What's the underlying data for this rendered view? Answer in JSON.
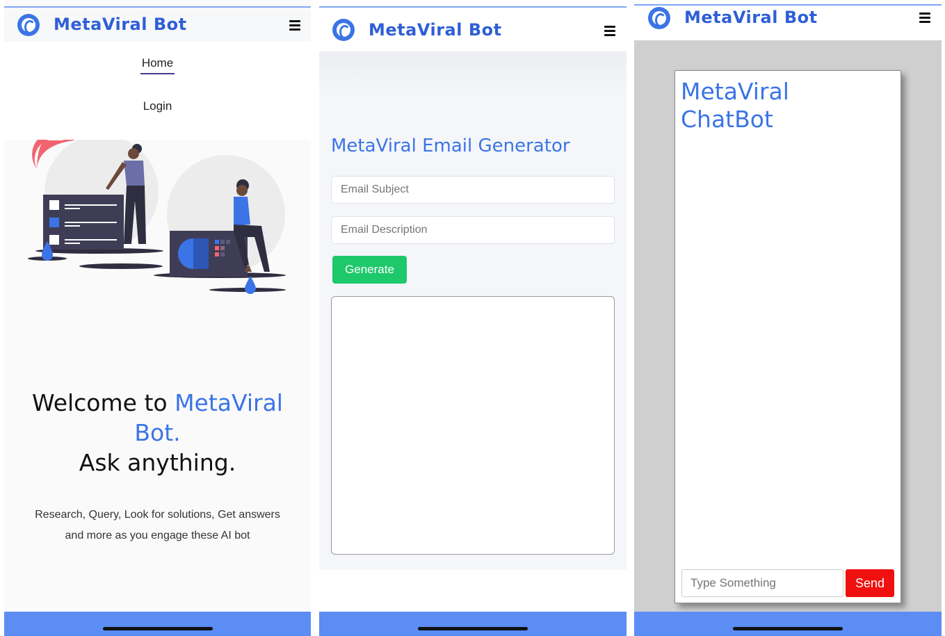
{
  "app": {
    "brand": "MetaViral Bot"
  },
  "home_screen": {
    "nav_links": [
      "Home",
      "Login"
    ],
    "welcome_prefix": "Welcome to ",
    "welcome_highlight": "MetaViral Bot.",
    "welcome_suffix": "Ask anything.",
    "description": "Research, Query, Look for solutions, Get answers and more as you engage these AI bot"
  },
  "email_screen": {
    "title": "MetaViral Email Generator",
    "subject_placeholder": "Email Subject",
    "description_placeholder": "Email Description",
    "generate_label": "Generate"
  },
  "chat_screen": {
    "title": "MetaViral ChatBot",
    "input_placeholder": "Type Something",
    "send_label": "Send"
  },
  "colors": {
    "brand_blue": "#3b74e6",
    "generate_green": "#1ec96b",
    "send_red": "#f01010",
    "bottom_bar": "#5b8df5"
  }
}
